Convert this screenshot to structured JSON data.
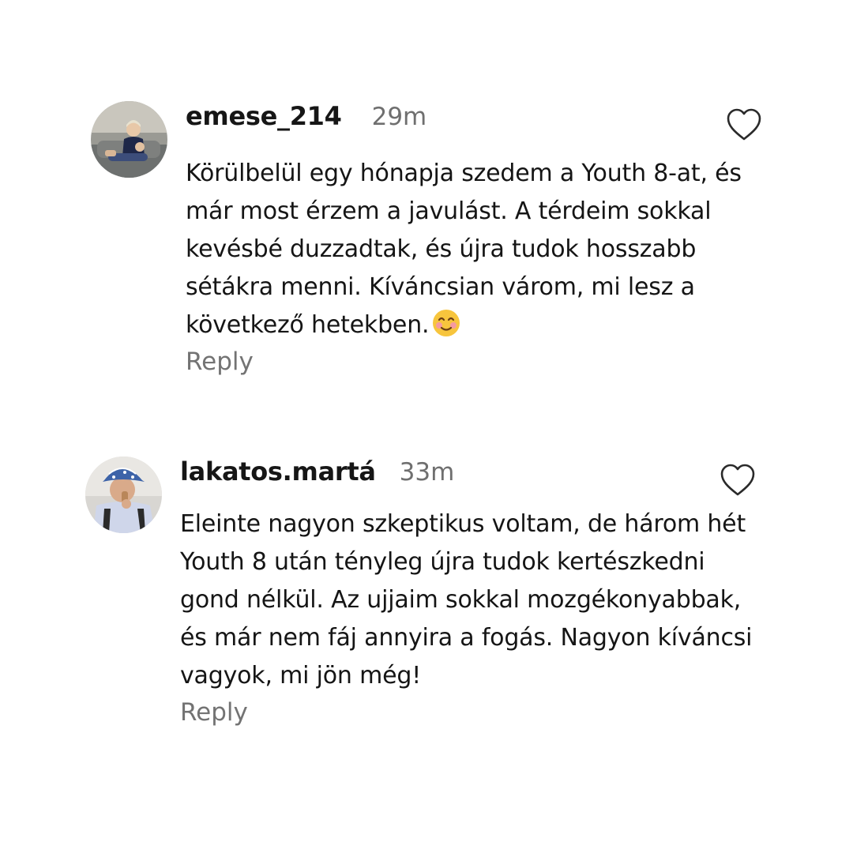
{
  "comments": [
    {
      "username": "emese_214",
      "time": "29m",
      "text": "Körülbelül egy hónapja szedem a Youth 8-at, és már most érzem a javulást. A térdeim sokkal kevésbé duzzadtak, és újra tudok hosszabb sétákra menni. Kíváncsian várom, mi lesz a következő hetekben.",
      "emoji": "smiling-face-icon",
      "reply_label": "Reply",
      "liked": false
    },
    {
      "username": "lakatos.martá",
      "time": "33m",
      "text": "Eleinte nagyon szkeptikus voltam, de három hét Youth 8 után tényleg újra tudok kertészkedni gond nélkül. Az ujjaim sokkal mozgékonyabbak, és már nem fáj annyira a fogás. Nagyon kíváncsi vagyok, mi jön még!",
      "reply_label": "Reply",
      "liked": false
    }
  ],
  "colors": {
    "username": "#161616",
    "meta": "#6f6f6f",
    "text": "#151515",
    "background": "#ffffff"
  }
}
